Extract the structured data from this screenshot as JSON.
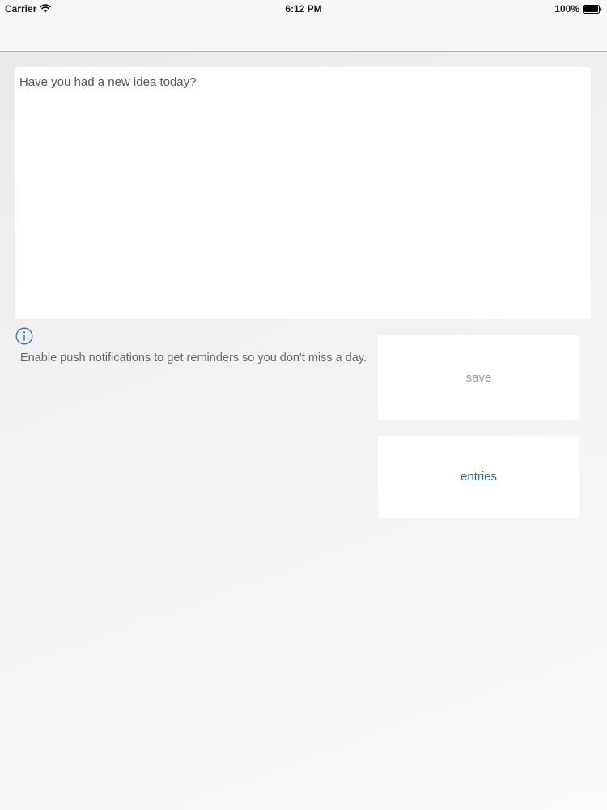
{
  "status_bar": {
    "carrier": "Carrier",
    "time": "6:12 PM",
    "battery": "100%",
    "icons": [
      "wifi-icon",
      "battery-icon"
    ]
  },
  "editor": {
    "placeholder": "Have you had a new idea today?",
    "value": ""
  },
  "notice": {
    "icon": "info-icon",
    "text": "Enable push notifications to get reminders so you don't miss a day."
  },
  "actions": {
    "save_label": "save",
    "entries_label": "entries"
  },
  "colors": {
    "accent": "#2a6eb0",
    "disabled": "#9a9a9a"
  }
}
